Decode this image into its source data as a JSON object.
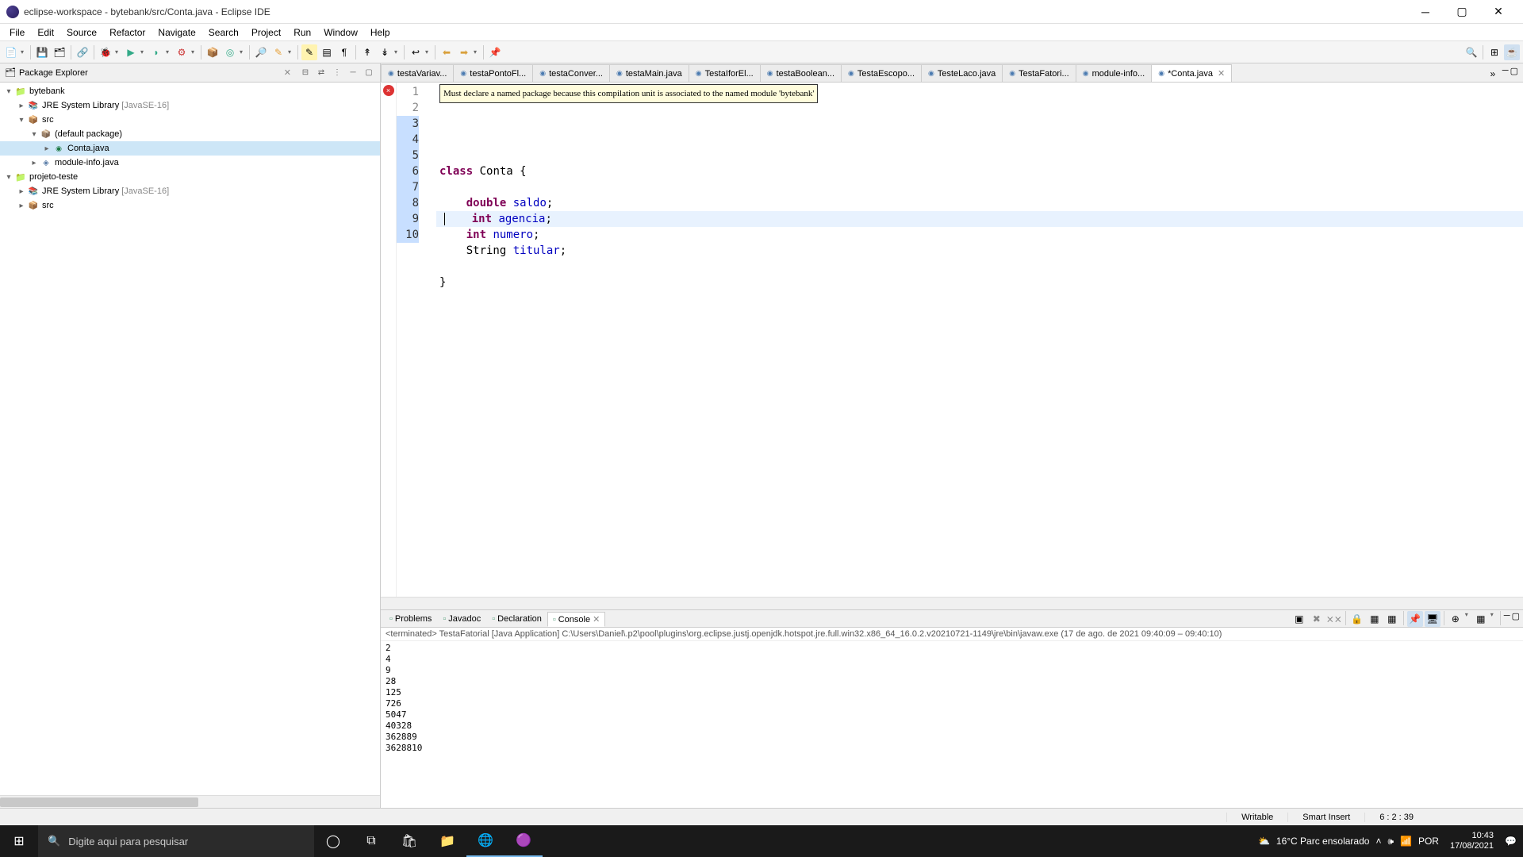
{
  "window": {
    "title": "eclipse-workspace - bytebank/src/Conta.java - Eclipse IDE"
  },
  "menubar": [
    "File",
    "Edit",
    "Source",
    "Refactor",
    "Navigate",
    "Search",
    "Project",
    "Run",
    "Window",
    "Help"
  ],
  "package_explorer": {
    "title": "Package Explorer",
    "projects": [
      {
        "name": "bytebank",
        "expanded": true,
        "children": [
          {
            "name": "JRE System Library",
            "meta": "[JavaSE-16]",
            "type": "lib",
            "indent": 1,
            "exp": "▸"
          },
          {
            "name": "src",
            "type": "src",
            "indent": 1,
            "exp": "▾",
            "children": [
              {
                "name": "(default package)",
                "type": "pkg",
                "indent": 2,
                "exp": "▾",
                "children": [
                  {
                    "name": "Conta.java",
                    "type": "java",
                    "indent": 3,
                    "exp": "▸",
                    "selected": true
                  }
                ]
              },
              {
                "name": "module-info.java",
                "type": "mod",
                "indent": 2,
                "exp": "▸"
              }
            ]
          }
        ]
      },
      {
        "name": "projeto-teste",
        "expanded": true,
        "children": [
          {
            "name": "JRE System Library",
            "meta": "[JavaSE-16]",
            "type": "lib",
            "indent": 1,
            "exp": "▸"
          },
          {
            "name": "src",
            "type": "src",
            "indent": 1,
            "exp": "▸"
          }
        ]
      }
    ]
  },
  "editor_tabs": [
    {
      "label": "testaVariav..."
    },
    {
      "label": "testaPontoFl..."
    },
    {
      "label": "testaConver..."
    },
    {
      "label": "testaMain.java"
    },
    {
      "label": "TestaIforEl..."
    },
    {
      "label": "testaBoolean..."
    },
    {
      "label": "TestaEscopo..."
    },
    {
      "label": "TesteLaco.java"
    },
    {
      "label": "TestaFatori..."
    },
    {
      "label": "module-info..."
    },
    {
      "label": "*Conta.java",
      "active": true,
      "closeable": true
    }
  ],
  "tooltip": "Must declare a named package because this compilation unit is associated to the named module 'bytebank'",
  "code": {
    "lines": [
      {
        "n": 1,
        "html": "",
        "error": true
      },
      {
        "n": 2,
        "html": ""
      },
      {
        "n": 3,
        "html": "<span class='kw'>class</span> Conta {"
      },
      {
        "n": 4,
        "html": ""
      },
      {
        "n": 5,
        "html": "    <span class='kw'>double</span> <span class='field'>saldo</span>;"
      },
      {
        "n": 6,
        "html": "    <span class='kw'>int</span> <span class='field'>agencia</span>;",
        "current": true,
        "cursor": true
      },
      {
        "n": 7,
        "html": "    <span class='kw'>int</span> <span class='field'>numero</span>;"
      },
      {
        "n": 8,
        "html": "    String <span class='field'>titular</span>;"
      },
      {
        "n": 9,
        "html": ""
      },
      {
        "n": 10,
        "html": "}"
      }
    ]
  },
  "bottom_tabs": [
    {
      "label": "Problems"
    },
    {
      "label": "Javadoc"
    },
    {
      "label": "Declaration"
    },
    {
      "label": "Console",
      "active": true,
      "closeable": true
    }
  ],
  "console": {
    "header": "<terminated> TestaFatorial [Java Application] C:\\Users\\Daniel\\.p2\\pool\\plugins\\org.eclipse.justj.openjdk.hotspot.jre.full.win32.x86_64_16.0.2.v20210721-1149\\jre\\bin\\javaw.exe  (17 de ago. de 2021 09:40:09 – 09:40:10)",
    "lines": [
      "2",
      "4",
      "9",
      "28",
      "125",
      "726",
      "5047",
      "40328",
      "362889",
      "3628810"
    ]
  },
  "statusbar": {
    "writable": "Writable",
    "insert": "Smart Insert",
    "pos": "6 : 2 : 39"
  },
  "taskbar": {
    "search_placeholder": "Digite aqui para pesquisar",
    "weather": "16°C  Parc ensolarado",
    "lang": "POR",
    "time": "10:43",
    "date": "17/08/2021"
  }
}
